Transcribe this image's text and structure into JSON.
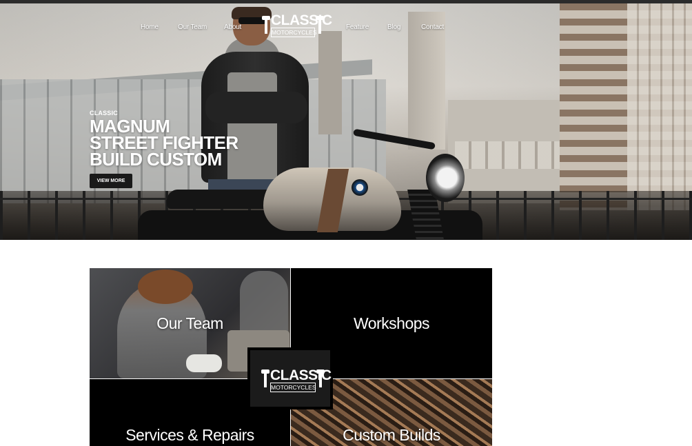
{
  "brand": {
    "logo_line1": "CLASSIC",
    "logo_line2": "MOTORCYCLES"
  },
  "nav": {
    "items": [
      {
        "label": "Home"
      },
      {
        "label": "Our Team"
      },
      {
        "label": "About"
      },
      {
        "label": "Feature"
      },
      {
        "label": "Blog"
      },
      {
        "label": "Contact"
      }
    ]
  },
  "hero": {
    "eyebrow": "CLASSIC",
    "headline_lines": [
      "MAGNUM",
      "STREET FIGHTER",
      "BUILD CUSTOM"
    ],
    "cta_label": "VIEW MORE"
  },
  "tiles": [
    {
      "label": "Our Team"
    },
    {
      "label": "Workshops"
    },
    {
      "label": "Services & Repairs"
    },
    {
      "label": "Custom Builds"
    }
  ],
  "colors": {
    "top_bar": "#2b2b2b",
    "tile_black": "#000000",
    "button_bg": "#1a1a1a",
    "text_white": "#ffffff"
  }
}
